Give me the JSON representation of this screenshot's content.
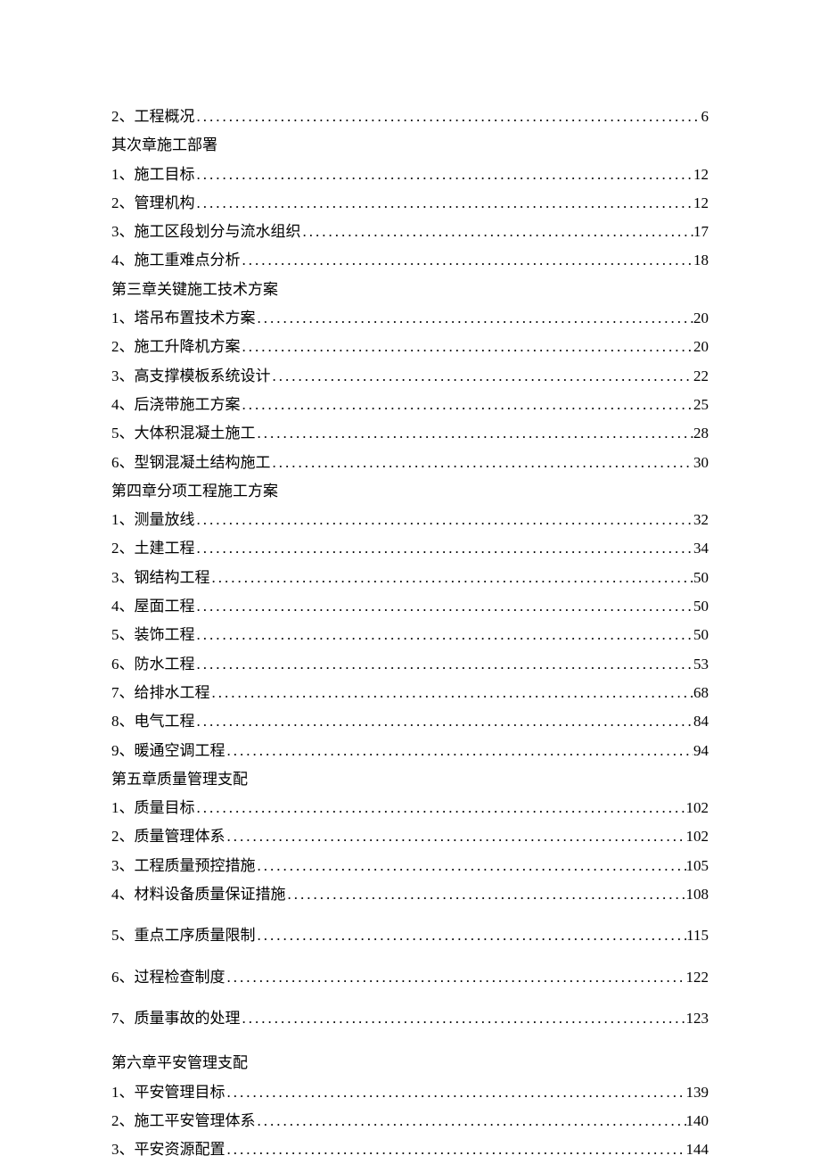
{
  "toc": {
    "pre_items": [
      {
        "label": "2、工程概况",
        "page": "6"
      }
    ],
    "sections": [
      {
        "heading": "其次章施工部署",
        "items": [
          {
            "label": "1、施工目标",
            "page": "12"
          },
          {
            "label": "2、管理机构",
            "page": "12"
          },
          {
            "label": "3、施工区段划分与流水组织",
            "page": "17"
          },
          {
            "label": "4、施工重难点分析",
            "page": "18"
          }
        ]
      },
      {
        "heading": "第三章关键施工技术方案",
        "items": [
          {
            "label": "1、塔吊布置技术方案",
            "page": "20"
          },
          {
            "label": "2、施工升降机方案",
            "page": "20"
          },
          {
            "label": "3、高支撑模板系统设计",
            "page": "22"
          },
          {
            "label": "4、后浇带施工方案",
            "page": "25"
          },
          {
            "label": "5、大体积混凝土施工",
            "page": "28"
          },
          {
            "label": "6、型钢混凝土结构施工",
            "page": "30"
          }
        ]
      },
      {
        "heading": "第四章分项工程施工方案",
        "items": [
          {
            "label": "1、测量放线",
            "page": "32"
          },
          {
            "label": "2、土建工程",
            "page": "34"
          },
          {
            "label": "3、钢结构工程",
            "page": "50"
          },
          {
            "label": "4、屋面工程",
            "page": "50"
          },
          {
            "label": "5、装饰工程",
            "page": "50"
          },
          {
            "label": "6、防水工程",
            "page": "53"
          },
          {
            "label": "7、给排水工程",
            "page": "68"
          },
          {
            "label": "8、电气工程",
            "page": "84"
          },
          {
            "label": "9、暖通空调工程",
            "page": "94"
          }
        ]
      },
      {
        "heading": "第五章质量管理支配",
        "items": [
          {
            "label": "1、质量目标",
            "page": "102"
          },
          {
            "label": "2、质量管理体系",
            "page": "102"
          },
          {
            "label": "3、工程质量预控措施",
            "page": "105"
          },
          {
            "label": "4、材料设备质量保证措施",
            "page": "108"
          },
          {
            "label": "5、重点工序质量限制",
            "page": "115",
            "gap": true
          },
          {
            "label": "6、过程检查制度",
            "page": "122",
            "gap": true
          },
          {
            "label": "7、质量事故的处理",
            "page": "123",
            "gap": true
          }
        ]
      },
      {
        "heading": "第六章平安管理支配",
        "heading_gap": true,
        "items": [
          {
            "label": "1、平安管理目标",
            "page": "139"
          },
          {
            "label": "2、施工平安管理体系",
            "page": "140"
          },
          {
            "label": "3、平安资源配置",
            "page": "144"
          }
        ]
      }
    ]
  }
}
